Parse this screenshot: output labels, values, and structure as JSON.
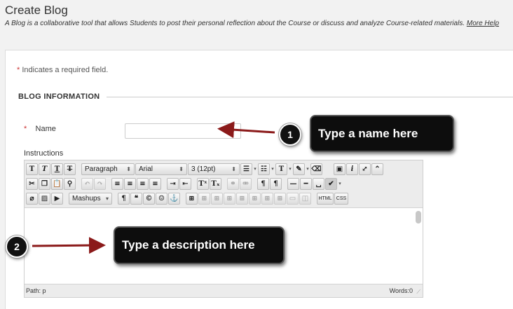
{
  "header": {
    "title": "Create Blog",
    "description": "A Blog is a collaborative tool that allows Students to post their personal reflection about the Course or discuss and analyze Course-related materials.",
    "help_link": "More Help"
  },
  "form": {
    "required_note": "Indicates a required field.",
    "required_star": "*",
    "section_title": "BLOG INFORMATION",
    "name_label": "Name",
    "name_value": "",
    "instructions_label": "Instructions"
  },
  "editor": {
    "paragraph_select": "Paragraph",
    "font_select": "Arial",
    "size_select": "3 (12pt)",
    "mashups_select": "Mashups",
    "path": "Path: p",
    "words": "Words:0",
    "html_button": "HTML",
    "css_button": "CSS"
  },
  "callouts": [
    {
      "number": "1",
      "text": "Type a name here"
    },
    {
      "number": "2",
      "text": "Type a description here"
    }
  ],
  "colors": {
    "arrow": "#8b1a1a",
    "callout_bg": "#0d0d0d",
    "required_star": "#cc3333"
  }
}
